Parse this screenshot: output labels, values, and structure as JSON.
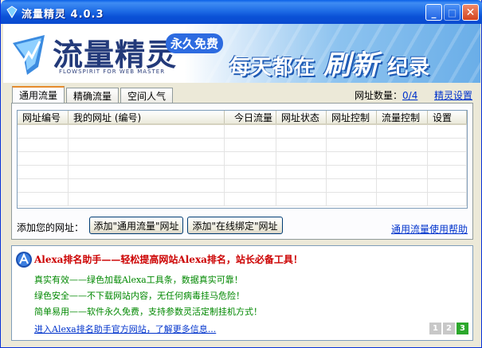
{
  "window": {
    "title": "流量精灵 4.0.3"
  },
  "banner": {
    "brand": "流量精灵",
    "tagline": "FLOWSPIRIT FOR WEB MASTER",
    "free_badge": "永久免费",
    "slogan_a": "每天都在",
    "slogan_b": "刷新",
    "slogan_c": "纪录"
  },
  "tabs": [
    {
      "label": "通用流量",
      "active": true
    },
    {
      "label": "精确流量",
      "active": false
    },
    {
      "label": "空间人气",
      "active": false
    }
  ],
  "url_count": {
    "label": "网址数量：",
    "value": "0/4"
  },
  "settings_label": "精灵设置",
  "grid": {
    "columns": [
      "网址编号",
      "我的网址 (编号)",
      "今日流量",
      "网址状态",
      "网址控制",
      "流量控制",
      "设置"
    ]
  },
  "add": {
    "label": "添加您的网址：",
    "general_button": "添加\"通用流量\"网址",
    "bind_button": "添加\"在线绑定\"网址"
  },
  "help_label": "通用流量使用帮助",
  "promo": {
    "title": "Alexa排名助手——轻松提高网站Alexa排名，站长必备工具！",
    "lines": [
      "真实有效——绿色加载Alexa工具条，数据真实可靠！",
      "绿色安全——不下载网站内容，无任何病毒挂马危险！",
      "简单易用——软件永久免费，支持参数灵活定制挂机方式！"
    ],
    "link": "进入Alexa排名助手官方网站，了解更多信息...",
    "pages": [
      "1",
      "2",
      "3"
    ]
  },
  "colors": {
    "titlebar": "#0a51d6",
    "link": "#0033cc",
    "promo_title": "#cc0000",
    "promo_text": "#008800",
    "active_page": "#2ca82c"
  }
}
